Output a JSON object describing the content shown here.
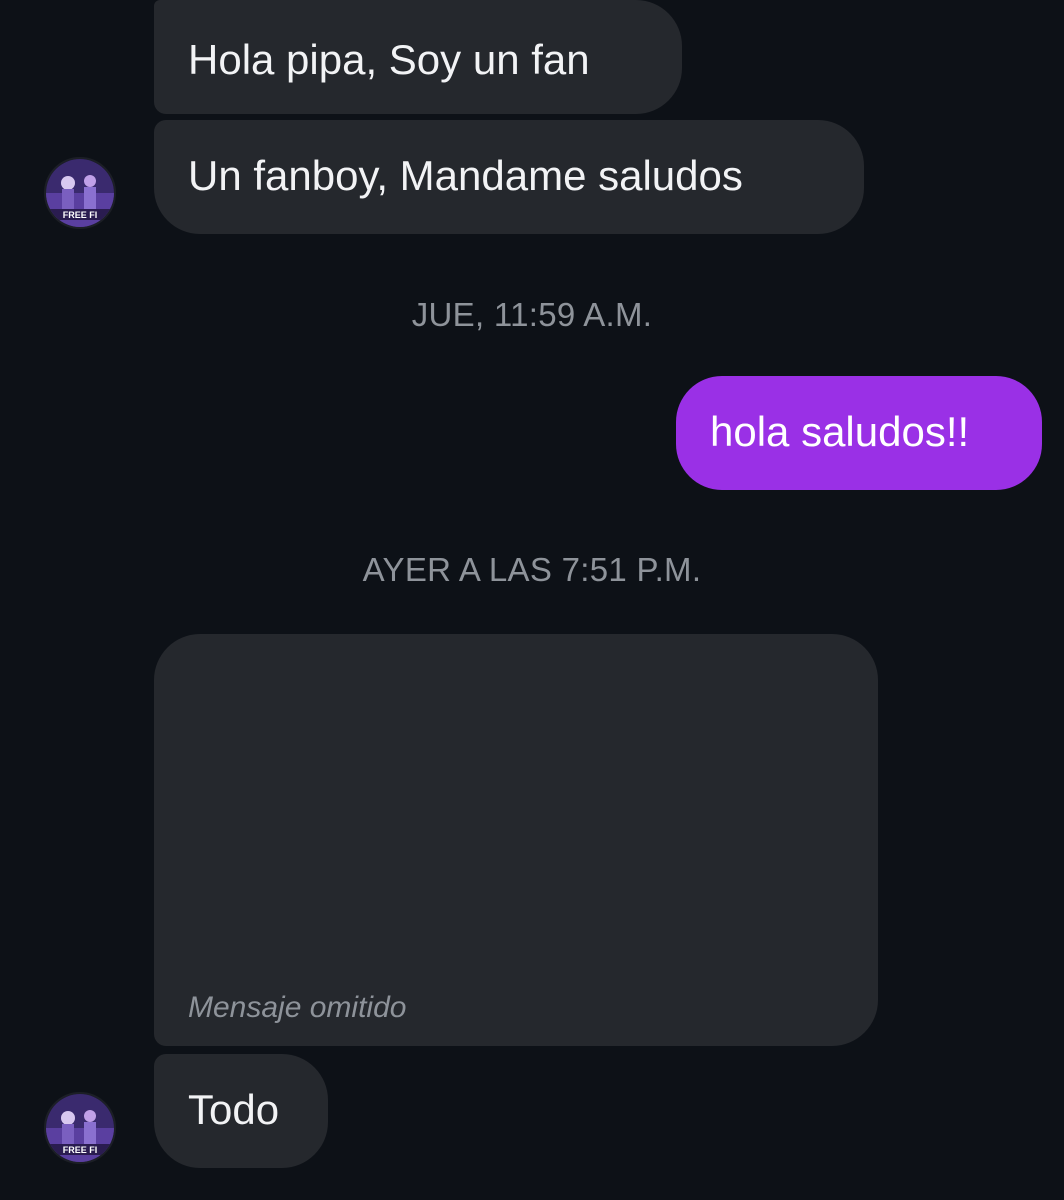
{
  "thread": {
    "messages": [
      {
        "direction": "incoming",
        "text": "Hola pipa, Soy un fan"
      },
      {
        "direction": "incoming",
        "text": "Un fanboy, Mandame saludos"
      },
      {
        "direction": "outgoing",
        "text": "hola saludos!!"
      },
      {
        "direction": "incoming",
        "text": "Todo"
      }
    ],
    "dividers": [
      "JUE, 11:59 A.M.",
      "AYER A LAS 7:51 P.M."
    ],
    "omitted_message_placeholder": "Mensaje omitido"
  },
  "avatar": {
    "icon": "game-avatar-icon",
    "caption": "FREE FI"
  },
  "colors": {
    "background": "#0d1117",
    "incoming_bubble": "#25282d",
    "outgoing_bubble": "#9a30e6",
    "timestamp_text": "#8e939a"
  }
}
